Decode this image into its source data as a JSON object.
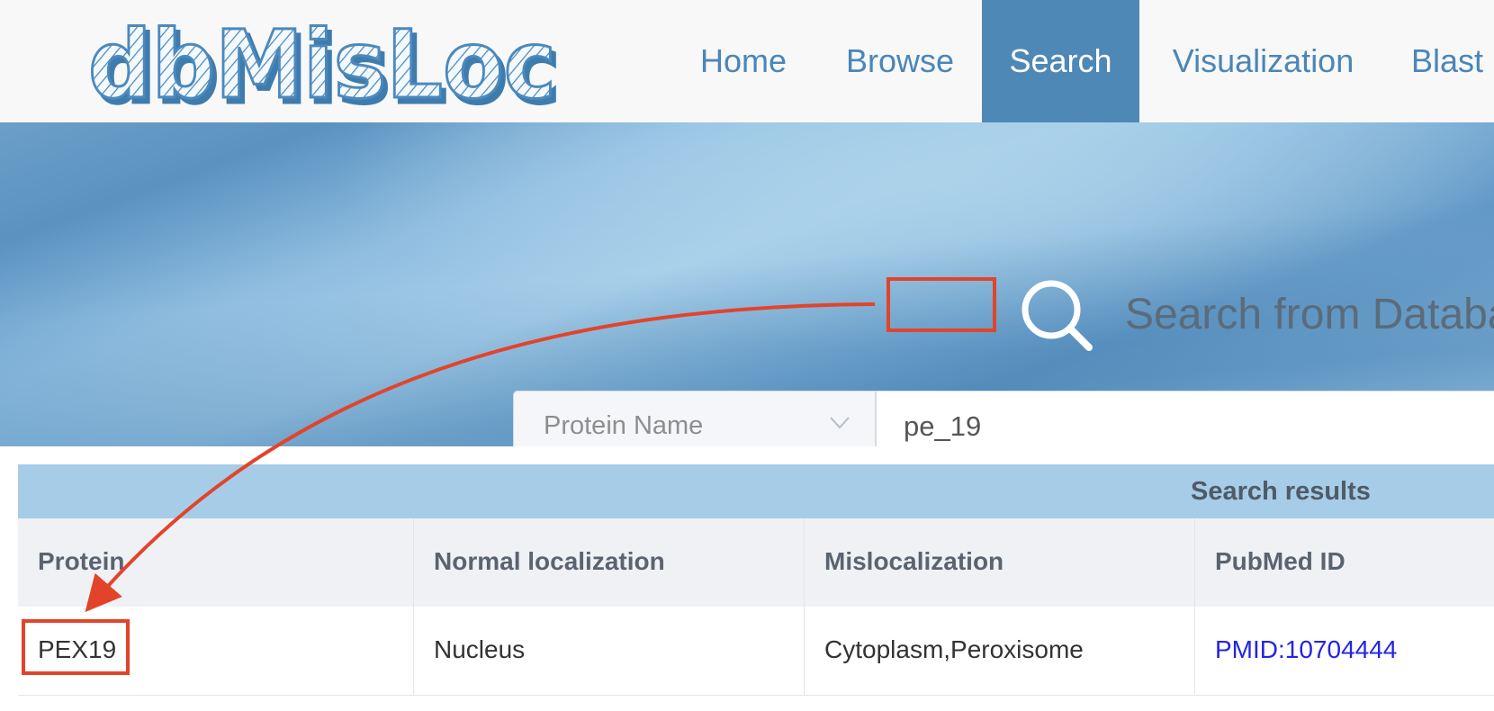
{
  "header": {
    "logo_text": "dbMisLoc",
    "nav": [
      {
        "label": "Home",
        "active": false
      },
      {
        "label": "Browse",
        "active": false
      },
      {
        "label": "Search",
        "active": true
      },
      {
        "label": "Visualization",
        "active": false
      },
      {
        "label": "Blast",
        "active": false
      }
    ]
  },
  "banner": {
    "title": "Search from Databa",
    "search_type": "Protein Name",
    "query": "pe_19"
  },
  "results": {
    "title": "Search results",
    "columns": [
      "Protein",
      "Normal localization",
      "Mislocalization",
      "PubMed ID"
    ],
    "rows": [
      {
        "protein": "PEX19",
        "normal": "Nucleus",
        "mislocalization": "Cytoplasm,Peroxisome",
        "pubmed": "PMID:10704444"
      }
    ]
  },
  "colors": {
    "brand": "#4e88b6",
    "nav_text": "#4a86b8",
    "annotation": "#e2442b",
    "link": "#2323e6",
    "table_header": "#a6cce8"
  }
}
